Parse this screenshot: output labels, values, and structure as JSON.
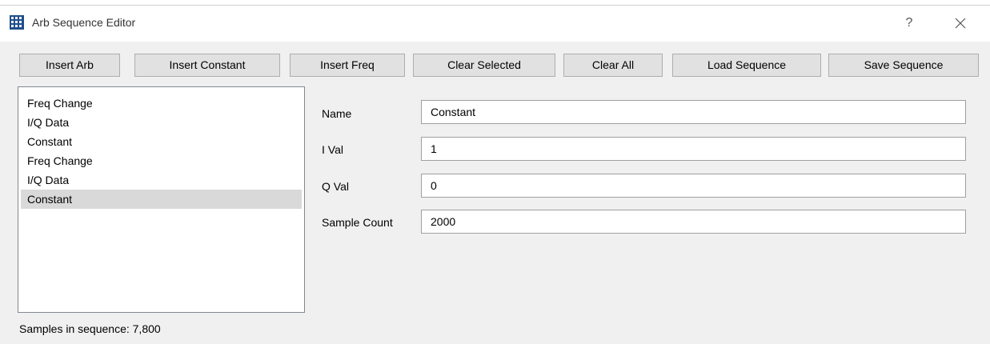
{
  "window": {
    "title": "Arb Sequence Editor",
    "help_label": "?",
    "icon": "grid-app-icon"
  },
  "toolbar": {
    "insert_arb": "Insert Arb",
    "insert_constant": "Insert Constant",
    "insert_freq": "Insert Freq",
    "clear_selected": "Clear Selected",
    "clear_all": "Clear All",
    "load_sequence": "Load Sequence",
    "save_sequence": "Save Sequence"
  },
  "sequence_list": {
    "items": [
      {
        "label": "Freq Change"
      },
      {
        "label": "I/Q Data"
      },
      {
        "label": "Constant"
      },
      {
        "label": "Freq Change"
      },
      {
        "label": "I/Q Data"
      },
      {
        "label": "Constant"
      }
    ],
    "selected_index": 5
  },
  "properties": {
    "name_label": "Name",
    "name_value": "Constant",
    "ival_label": "I Val",
    "ival_value": "1",
    "qval_label": "Q Val",
    "qval_value": "0",
    "sample_count_label": "Sample Count",
    "sample_count_value": "2000"
  },
  "status": {
    "samples_text": "Samples in sequence: 7,800"
  },
  "colors": {
    "window_bg": "#f0f0f0",
    "button_bg": "#e1e1e1",
    "selected_item_bg": "#d9d9d9",
    "app_icon": "#1f4e8c"
  }
}
